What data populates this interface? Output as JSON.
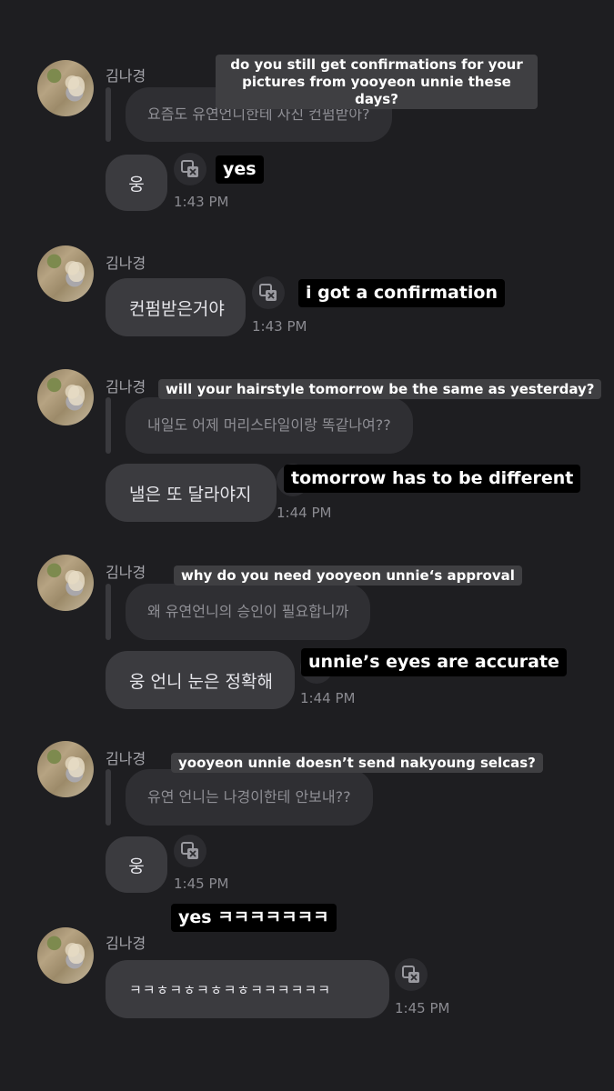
{
  "sender": "김나경",
  "messages": [
    {
      "quote": "요즘도 유연언니한테 사진 컨펌받아?",
      "quote_translation": "do you still get confirmations for your\npictures from yooyeon unnie these days?",
      "text": "웅",
      "time": "1:43 PM",
      "translation": "yes"
    },
    {
      "text": "컨펌받은거야",
      "time": "1:43 PM",
      "translation": "i got a confirmation"
    },
    {
      "quote": "내일도 어제 머리스타일이랑 똑같나여??",
      "quote_translation": "will your hairstyle tomorrow be the same as yesterday?",
      "text": "낼은 또 달라야지",
      "time": "1:44 PM",
      "translation": "tomorrow has to be different"
    },
    {
      "quote": "왜 유연언니의 승인이 필요합니까",
      "quote_translation": "why do you need yooyeon unnie‘s approval",
      "text": "웅 언니 눈은 정확해",
      "time": "1:44 PM",
      "translation": "unnie’s eyes are accurate"
    },
    {
      "quote": "유연 언니는 나경이한테 안보내??",
      "quote_translation": "yooyeon unnie doesn’t send nakyoung selcas?",
      "text": "웅",
      "time": "1:45 PM",
      "translation": "yes ㅋㅋㅋㅋㅋㅋㅋ"
    },
    {
      "text": "ㅋㅋㅎㅋㅎㅋㅎㅋㅎㅋㅋㅋㅋㅋㅋ",
      "time": "1:45 PM"
    }
  ],
  "icons": {
    "translate": "translate-icon",
    "avatar": "profile-avatar"
  },
  "colors": {
    "background": "#1e1e21",
    "bubble": "#3b3b3f",
    "quote_bubble": "#2f2f33",
    "caption_gray": "#3f3f42",
    "caption_black": "#000000"
  }
}
